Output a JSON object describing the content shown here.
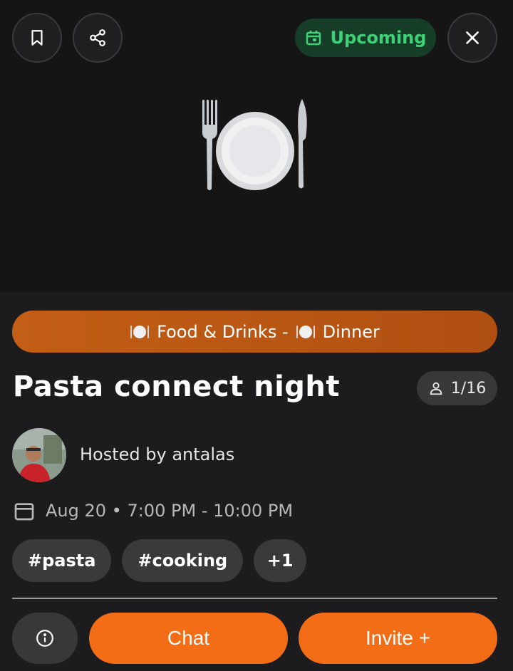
{
  "header": {
    "status_label": "Upcoming",
    "icons": [
      "bookmark-icon",
      "share-icon",
      "calendar-icon",
      "close-icon"
    ],
    "status_color": "#3ed177"
  },
  "hero": {
    "emoji": "fork-knife-plate"
  },
  "category": {
    "label": "Food & Drinks - ",
    "sub_label": "Dinner",
    "color": "#c25e15"
  },
  "event": {
    "title": "Pasta connect night",
    "capacity": "1/16",
    "host_text": "Hosted by antalas",
    "datetime": "Aug 20 • 7:00 PM - 10:00 PM"
  },
  "tags": [
    "#pasta",
    "#cooking",
    "+1"
  ],
  "actions": {
    "chat_label": "Chat",
    "invite_label": "Invite +",
    "accent_color": "#f26d15"
  }
}
